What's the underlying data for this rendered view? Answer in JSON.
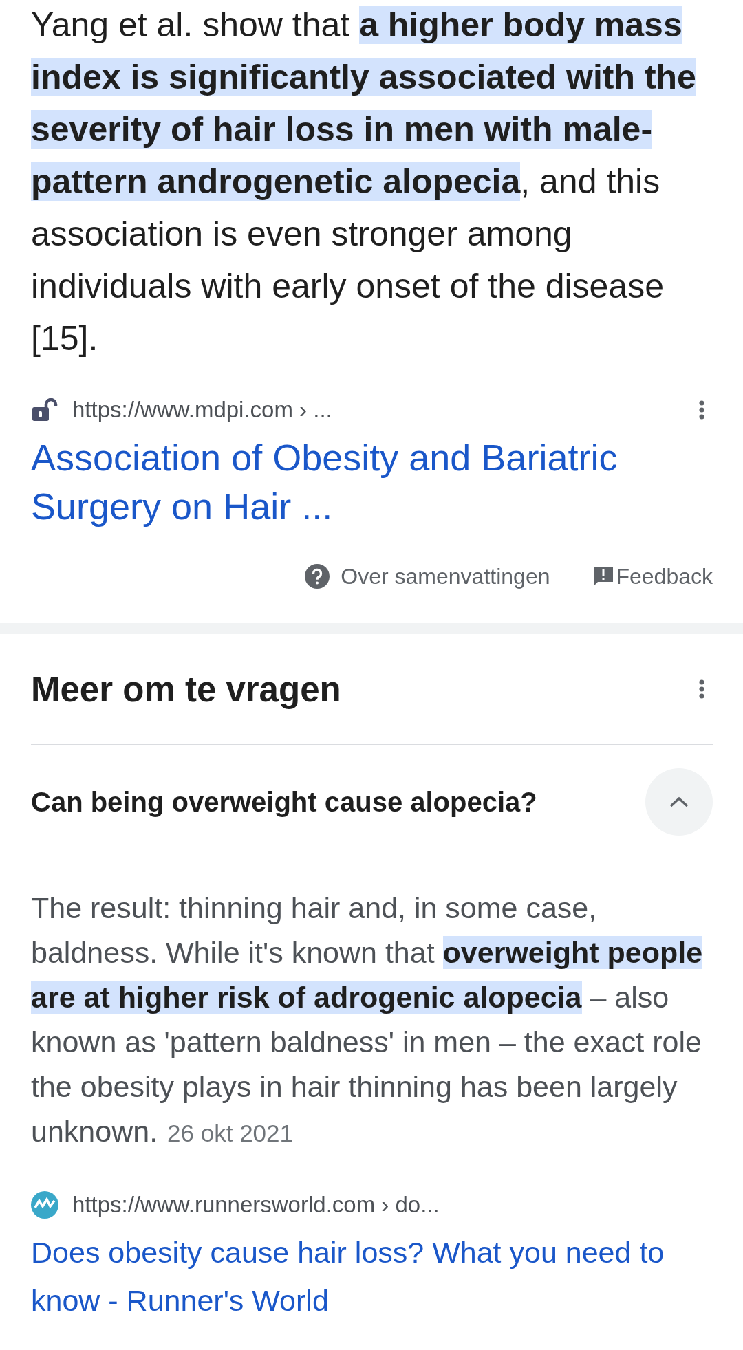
{
  "overview": {
    "text": "Yang et al. show that **a higher body mass index is significantly associated with the severity of hair loss in men with male-pattern androgenetic alopecia**, and this association is even stronger among individuals with early onset of the disease [15].",
    "source": {
      "url": "https://www.mdpi.com › ...",
      "title": "Association of Obesity and Bariatric Surgery on Hair ..."
    },
    "footer": {
      "about": "Over samenvattingen",
      "feedback": "Feedback"
    }
  },
  "related_questions": {
    "title": "Meer om te vragen",
    "items": [
      {
        "question": "Can being overweight cause alopecia?",
        "expanded": true,
        "answer": "The result: thinning hair and, in some case, baldness. While it's known that **overweight people are at higher risk of adrogenic alopecia** – also known as 'pattern baldness' in men – the exact role the obesity plays in hair thinning has been largely unknown.",
        "date": "26 okt 2021",
        "source": {
          "url": "https://www.runnersworld.com › do...",
          "title": "Does obesity cause hair loss? What you need to know - Runner's World"
        }
      }
    ]
  }
}
